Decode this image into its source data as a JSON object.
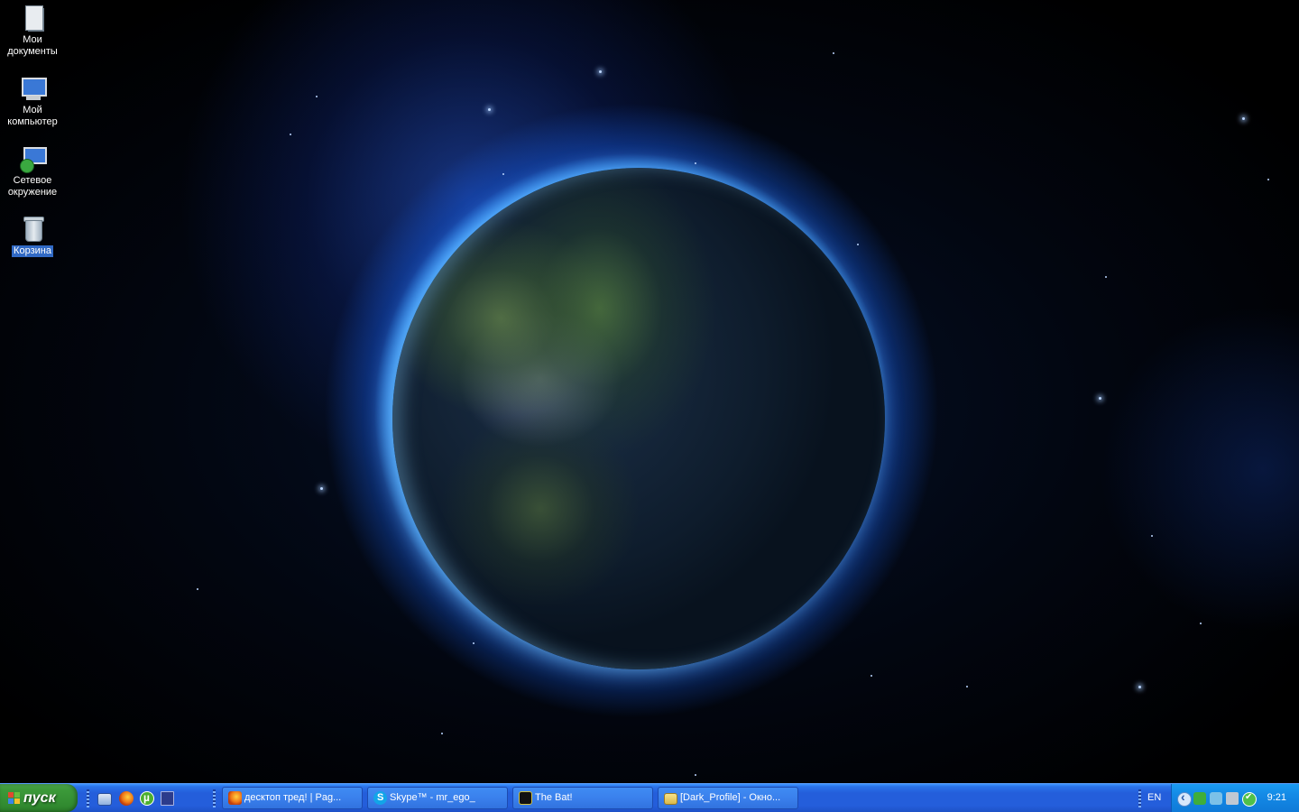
{
  "desktop": {
    "icons": [
      {
        "label_line1": "Мои",
        "label_line2": "документы",
        "icon": "my-documents-icon"
      },
      {
        "label_line1": "Мой",
        "label_line2": "компьютер",
        "icon": "my-computer-icon"
      },
      {
        "label_line1": "Сетевое",
        "label_line2": "окружение",
        "icon": "network-places-icon"
      },
      {
        "label_line1": "Корзина",
        "label_line2": "",
        "icon": "recycle-bin-icon",
        "selected": true
      }
    ]
  },
  "taskbar": {
    "start_label": "пуск",
    "quick_launch": [
      "show-desktop-icon",
      "firefox-icon",
      "utorrent-icon",
      "save-icon"
    ],
    "tasks": [
      {
        "label": "десктоп тред! | Pag...",
        "icon": "firefox-icon"
      },
      {
        "label": "Skype™ - mr_ego_",
        "icon": "skype-icon"
      },
      {
        "label": "The Bat!",
        "icon": "the-bat-icon"
      },
      {
        "label": "[Dark_Profile] - Окно...",
        "icon": "folder-icon"
      }
    ],
    "language": "EN",
    "tray_icons": [
      "tray-arrow-icon",
      "tray-green-icon",
      "tray-network-icon",
      "tray-monitor-icon",
      "tray-check-icon"
    ],
    "clock": "9:21"
  },
  "colors": {
    "taskbar_blue": "#245edb",
    "start_green": "#3c9a3a",
    "tray_blue": "#148ae6",
    "selection_blue": "#316ac5"
  }
}
